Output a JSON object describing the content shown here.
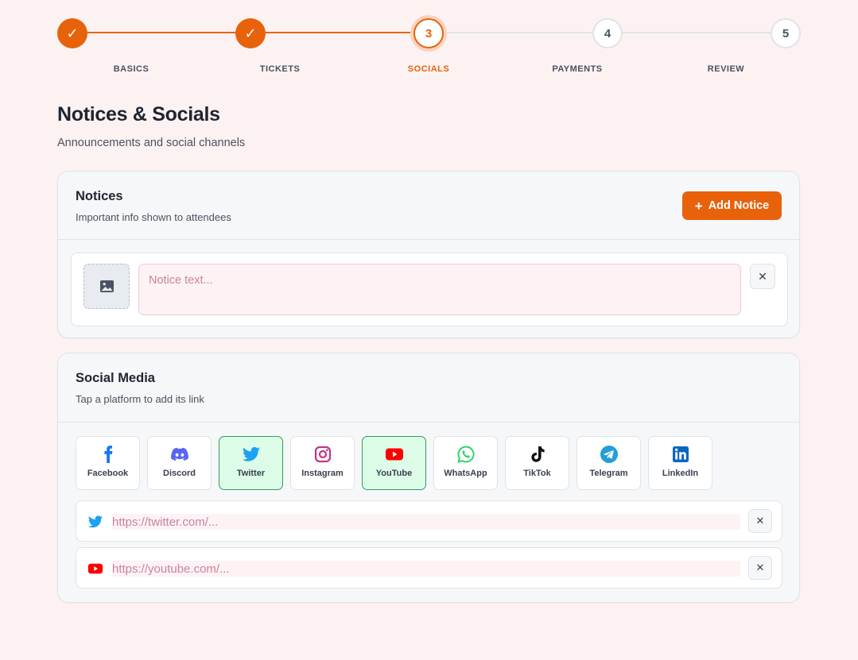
{
  "stepper": {
    "steps": [
      {
        "number": "1",
        "label": "BASICS",
        "state": "done"
      },
      {
        "number": "2",
        "label": "TICKETS",
        "state": "done"
      },
      {
        "number": "3",
        "label": "SOCIALS",
        "state": "active"
      },
      {
        "number": "4",
        "label": "PAYMENTS",
        "state": "todo"
      },
      {
        "number": "5",
        "label": "REVIEW",
        "state": "todo"
      }
    ],
    "done_glyph": "✓"
  },
  "page": {
    "title": "Notices & Socials",
    "subtitle": "Announcements and social channels"
  },
  "notices": {
    "title": "Notices",
    "description": "Important info shown to attendees",
    "add_button": "Add Notice",
    "add_icon": "+",
    "items": [
      {
        "placeholder": "Notice text...",
        "value": "",
        "image_icon": "image-icon",
        "remove": "✕"
      }
    ]
  },
  "social": {
    "title": "Social Media",
    "description": "Tap a platform to add its link",
    "platforms": [
      {
        "label": "Facebook",
        "icon": "facebook-icon",
        "color": "#1877f2",
        "selected": false
      },
      {
        "label": "Discord",
        "icon": "discord-icon",
        "color": "#5865f2",
        "selected": false
      },
      {
        "label": "Twitter",
        "icon": "twitter-icon",
        "color": "#1da1f2",
        "selected": true
      },
      {
        "label": "Instagram",
        "icon": "instagram-icon",
        "color": "#c13584",
        "selected": false
      },
      {
        "label": "YouTube",
        "icon": "youtube-icon",
        "color": "#ff0000",
        "selected": true
      },
      {
        "label": "WhatsApp",
        "icon": "whatsapp-icon",
        "color": "#25d366",
        "selected": false
      },
      {
        "label": "TikTok",
        "icon": "tiktok-icon",
        "color": "#111111",
        "selected": false
      },
      {
        "label": "Telegram",
        "icon": "telegram-icon",
        "color": "#229ed9",
        "selected": false
      },
      {
        "label": "LinkedIn",
        "icon": "linkedin-icon",
        "color": "#0a66c2",
        "selected": false
      }
    ],
    "links": [
      {
        "platform": "Twitter",
        "icon": "twitter-icon",
        "placeholder": "https://twitter.com/...",
        "value": "",
        "remove": "✕"
      },
      {
        "platform": "YouTube",
        "icon": "youtube-icon",
        "placeholder": "https://youtube.com/...",
        "value": "",
        "remove": "✕"
      }
    ]
  },
  "colors": {
    "accent": "#e8620b",
    "background": "#fdf2f2",
    "selected_bg": "#dcfce7",
    "selected_border": "#2f9e5e"
  }
}
